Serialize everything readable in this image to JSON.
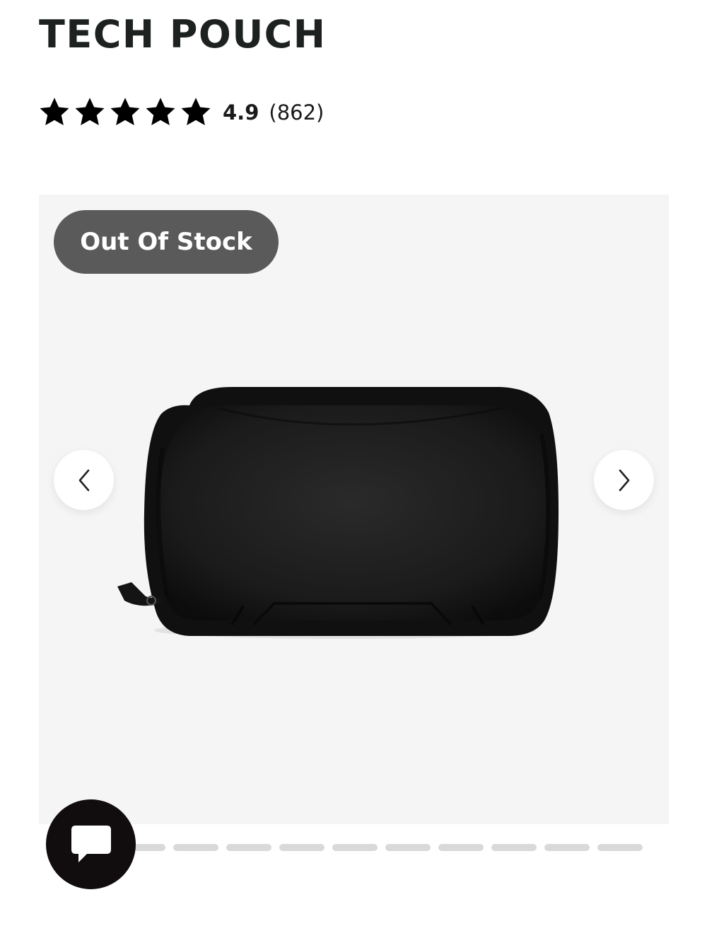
{
  "product": {
    "title": "TECH POUCH",
    "rating": {
      "stars_filled": 5,
      "stars_total": 5,
      "value": "4.9",
      "count": "(862)"
    }
  },
  "gallery": {
    "badge": "Out Of Stock",
    "image_icon": "product-photo-black-tech-pouch",
    "prev_icon": "chevron-left-icon",
    "next_icon": "chevron-right-icon",
    "slide_count": 11,
    "active_slide": 1
  },
  "chat": {
    "icon": "chat-bubble-icon"
  },
  "colors": {
    "background": "#ffffff",
    "gallery_background": "#f5f5f5",
    "badge_background": "#5a5a5a",
    "star": "#000000",
    "dot_inactive": "#d9d9d9",
    "chat_button": "#110c0d"
  }
}
